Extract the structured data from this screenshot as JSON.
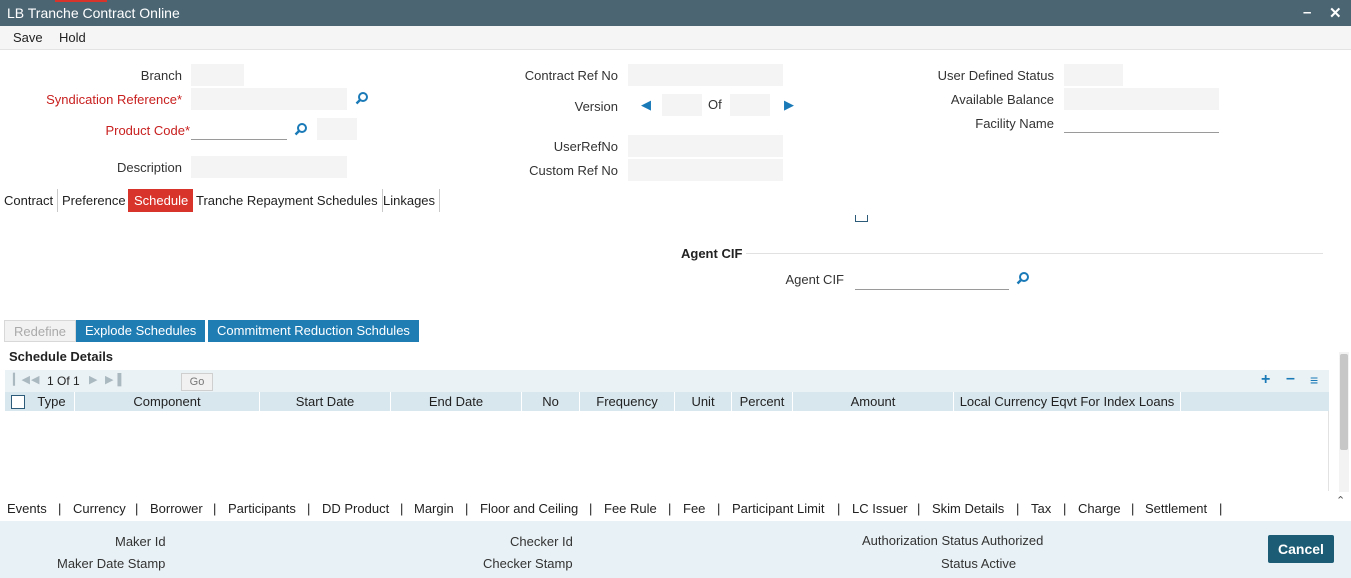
{
  "window": {
    "title": "LB Tranche Contract Online",
    "minimize": "–",
    "close": "✕"
  },
  "menu": {
    "save": "Save",
    "hold": "Hold"
  },
  "header": {
    "branch_label": "Branch",
    "syndication_ref_label": "Syndication Reference",
    "product_code_label": "Product Code",
    "description_label": "Description",
    "contract_ref_label": "Contract Ref No",
    "version_label": "Version",
    "version_of": "Of",
    "userrefno_label": "UserRefNo",
    "custom_ref_label": "Custom Ref No",
    "user_defined_status_label": "User Defined Status",
    "available_balance_label": "Available Balance",
    "facility_name_label": "Facility Name",
    "required_marker": "*"
  },
  "tabs": [
    {
      "label": "Contract"
    },
    {
      "label": "Preference"
    },
    {
      "label": "Schedule"
    },
    {
      "label": "Tranche Repayment Schedules"
    },
    {
      "label": "Linkages"
    }
  ],
  "agent": {
    "section_title": "Agent CIF",
    "field_label": "Agent CIF"
  },
  "buttons": {
    "redefine": "Redefine",
    "explode": "Explode Schedules",
    "commitment": "Commitment Reduction Schdules"
  },
  "schedule": {
    "title": "Schedule Details",
    "pager": "1 Of 1",
    "go": "Go",
    "columns": [
      "Type",
      "Component",
      "Start Date",
      "End Date",
      "No",
      "Frequency",
      "Unit",
      "Percent",
      "Amount",
      "Local Currency Eqvt For Index Loans"
    ]
  },
  "links": [
    "Events",
    "Currency",
    "Borrower",
    "Participants",
    "DD Product",
    "Margin",
    "Floor and Ceiling",
    "Fee Rule",
    "Fee",
    "Participant Limit",
    "LC Issuer",
    "Skim Details",
    "Tax",
    "Charge",
    "Settlement"
  ],
  "link_separator": "|",
  "footer": {
    "maker_id": "Maker Id",
    "maker_date_stamp": "Maker Date Stamp",
    "checker_id": "Checker Id",
    "checker_stamp": "Checker Stamp",
    "authorization_status": "Authorization Status Authorized",
    "status": "Status Active",
    "cancel": "Cancel"
  },
  "colors": {
    "titlebar": "#4b6573",
    "active_tab": "#d9342b",
    "primary_button": "#1f7db4",
    "required": "#c8201f"
  }
}
